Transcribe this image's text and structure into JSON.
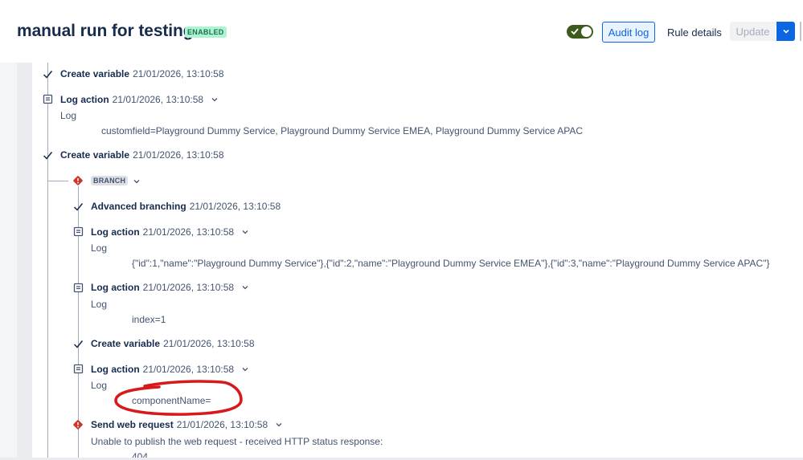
{
  "header": {
    "title": "manual run for testing",
    "status_badge": "ENABLED",
    "toggle_on": true,
    "audit_log_label": "Audit log",
    "rule_details_label": "Rule details",
    "update_label": "Update"
  },
  "log": {
    "entry1": {
      "label": "Create variable",
      "time": "21/01/2026, 13:10:58"
    },
    "entry2": {
      "label": "Log action",
      "time": "21/01/2026, 13:10:58",
      "sub": "Log",
      "message": "customfield=Playground Dummy Service, Playground Dummy Service EMEA, Playground Dummy Service APAC"
    },
    "entry3": {
      "label": "Create variable",
      "time": "21/01/2026, 13:10:58"
    },
    "branch": {
      "badge": "BRANCH"
    },
    "entry4": {
      "label": "Advanced branching",
      "time": "21/01/2026, 13:10:58"
    },
    "entry5": {
      "label": "Log action",
      "time": "21/01/2026, 13:10:58",
      "sub": "Log",
      "message": "{\"id\":1,\"name\":\"Playground Dummy Service\"},{\"id\":2,\"name\":\"Playground Dummy Service EMEA\"},{\"id\":3,\"name\":\"Playground Dummy Service APAC\"}"
    },
    "entry6": {
      "label": "Log action",
      "time": "21/01/2026, 13:10:58",
      "sub": "Log",
      "message": "index=1"
    },
    "entry7": {
      "label": "Create variable",
      "time": "21/01/2026, 13:10:58"
    },
    "entry8": {
      "label": "Log action",
      "time": "21/01/2026, 13:10:58",
      "sub": "Log",
      "message": "componentName="
    },
    "entry9": {
      "label": "Send web request",
      "time": "21/01/2026, 13:10:58",
      "message": "Unable to publish the web request - received HTTP status response:",
      "code": "404"
    }
  },
  "colors": {
    "accent": "#0c66e4",
    "enabled_badge_bg": "#abf5d1",
    "error_icon": "#c9372c",
    "annotation_circle": "#d7191c"
  }
}
